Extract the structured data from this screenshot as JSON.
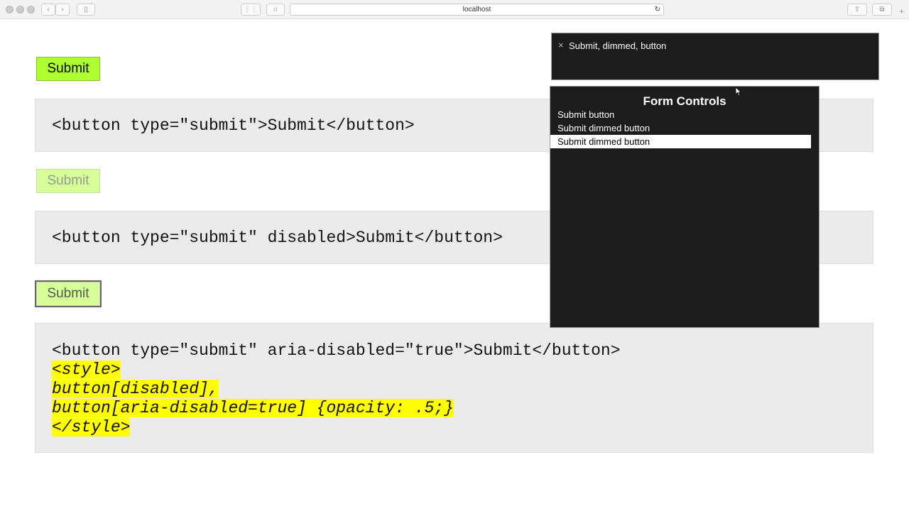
{
  "browser": {
    "url": "localhost"
  },
  "buttons": [
    {
      "label": "Submit"
    },
    {
      "label": "Submit"
    },
    {
      "label": "Submit"
    }
  ],
  "code": [
    [
      "<button type=\"submit\">Submit</button>"
    ],
    [
      "<button type=\"submit\" disabled>Submit</button>"
    ],
    [
      "<button type=\"submit\" aria-disabled=\"true\">Submit</button>"
    ]
  ],
  "highlighted_code": [
    "<style>",
    "button[disabled],",
    "button[aria-disabled=true] {opacity: .5;}",
    "</style>"
  ],
  "voiceover": {
    "caption": "Submit, dimmed, button",
    "close_icon": "×"
  },
  "rotor": {
    "title": "Form Controls",
    "items": [
      "Submit button",
      "Submit dimmed button",
      "Submit dimmed button"
    ],
    "selected_index": 2
  },
  "colors": {
    "button": "#adff2f",
    "highlight": "#ffff00",
    "panel": "#1c1c1c"
  }
}
